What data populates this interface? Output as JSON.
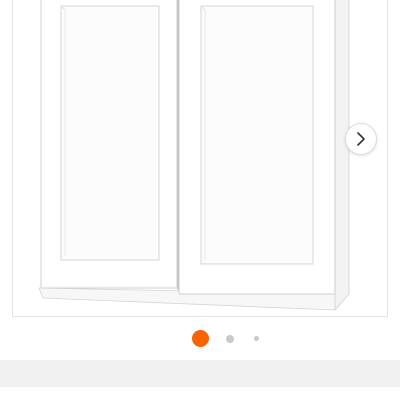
{
  "product_gallery": {
    "image_description_label": "",
    "next_icon": "chevron-right-icon",
    "total_images": 3,
    "current_image": 1
  },
  "colors": {
    "active_dot": "#f96302",
    "inactive_dot": "#c8c8c8",
    "divider": "#f0f0f0",
    "cabinet_outline": "#cfcfcf",
    "chevron": "#333333"
  }
}
